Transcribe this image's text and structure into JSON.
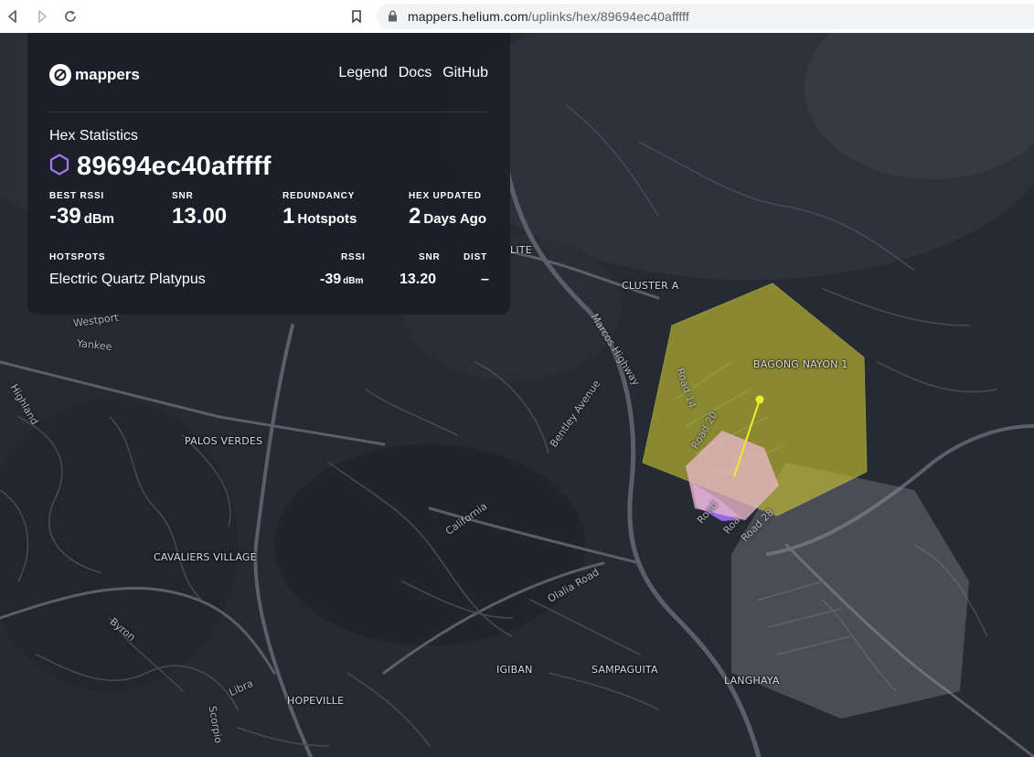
{
  "browser": {
    "url_host": "mappers.helium.com",
    "url_path": "/uplinks/hex/89694ec40afffff"
  },
  "panel": {
    "brand": "mappers",
    "links": [
      "Legend",
      "Docs",
      "GitHub"
    ],
    "heading": "Hex Statistics",
    "hex_id": "89694ec40afffff",
    "stats": {
      "best_rssi": {
        "label": "BEST RSSI",
        "value": "-39",
        "unit": "dBm"
      },
      "snr": {
        "label": "SNR",
        "value": "13.00"
      },
      "redundancy": {
        "label": "REDUNDANCY",
        "value": "1",
        "unit": "Hotspots"
      },
      "updated": {
        "label": "HEX UPDATED",
        "value": "2",
        "unit": "Days Ago"
      }
    },
    "table": {
      "headers": {
        "hotspots": "HOTSPOTS",
        "rssi": "RSSI",
        "snr": "SNR",
        "dist": "DIST"
      },
      "rows": [
        {
          "name": "Electric Quartz Platypus",
          "rssi": "-39",
          "rssi_unit": "dBm",
          "snr": "13.20",
          "dist": "–"
        }
      ]
    }
  },
  "map": {
    "place_labels": {
      "lite": "LITE",
      "cluster_a": "CLUSTER A",
      "bagong_nayon": "BAGONG NAYON 1",
      "palos_verdes": "PALOS VERDES",
      "cavaliers": "CAVALIERS VILLAGE",
      "hopeville": "HOPEVILLE",
      "igiban": "IGIBAN",
      "sampaguita": "SAMPAGUITA",
      "langhaya": "LANGHAYA"
    },
    "road_labels": {
      "westport": "Westport",
      "yankee": "Yankee",
      "highland": "Highland",
      "marcos": "Marcos Highway",
      "bentley": "Bentley Avenue",
      "california": "California",
      "olalia": "Olalia Road",
      "byron": "Byron",
      "libra": "Libra",
      "scorpio": "Scorpio",
      "road14": "Road 14",
      "road20": "Road 20",
      "road28": "Road 28",
      "road_a": "Road",
      "road_b": "Roa"
    },
    "colors": {
      "large_hex": "#c8c431",
      "hotspot_hex": "#e9b7c8",
      "purple_hex": "#9b6cf0",
      "grey_hex": "#8e9099",
      "link_line": "#f0ec2a"
    }
  }
}
